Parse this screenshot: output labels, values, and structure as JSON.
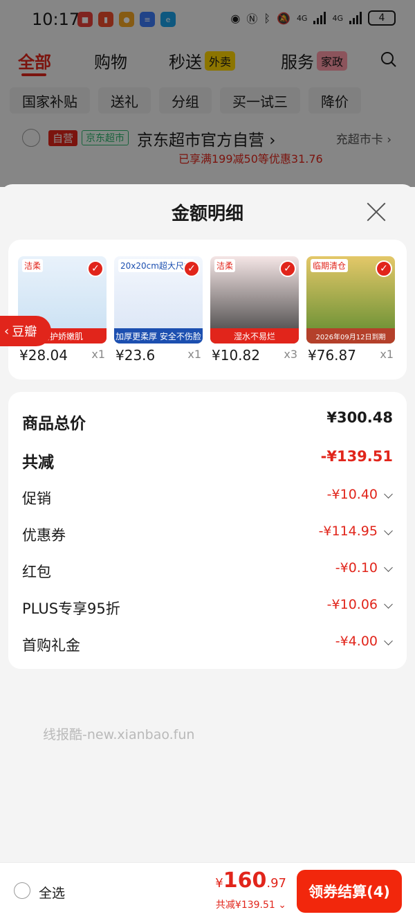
{
  "status_bar": {
    "time": "10:17",
    "battery": "4",
    "network_1": "4G",
    "network_2": "4G"
  },
  "top_tabs": [
    {
      "label": "全部",
      "active": true
    },
    {
      "label": "购物",
      "active": false
    },
    {
      "label": "秒送",
      "badge": "外卖",
      "active": false
    },
    {
      "label": "服务",
      "badge": "家政",
      "active": false
    }
  ],
  "filter_chips": [
    "国家补贴",
    "送礼",
    "分组",
    "买一试三",
    "降价"
  ],
  "store": {
    "tag_self": "自营",
    "tag_market": "京东超市",
    "name": "京东超市官方自营",
    "card_link": "充超市卡",
    "promo": "已享满199减50等优惠31.76"
  },
  "sheet": {
    "title": "金额明细"
  },
  "products": [
    {
      "price": "¥28.04",
      "qty": "x1",
      "label": "洁柔",
      "band": "呵护娇嫩肌",
      "color": "#c7dff2"
    },
    {
      "price": "¥23.6",
      "qty": "x1",
      "label": "20x20cm超大尺寸",
      "band": "加厚更柔厚 安全不伤脸",
      "color": "#d9e4f5"
    },
    {
      "price": "¥10.82",
      "qty": "x3",
      "label": "洁柔",
      "band": "湿水不易烂",
      "color": "#3a3a3a"
    },
    {
      "price": "¥76.87",
      "qty": "x1",
      "label": "临期清仓",
      "band": "2026年09月12日到期",
      "color": "#c9a23a"
    }
  ],
  "side_tag": "豆瓣",
  "price_detail": {
    "total_label": "商品总价",
    "total_value": "¥300.48",
    "discount_label": "共减",
    "discount_value": "-¥139.51",
    "items": [
      {
        "label": "促销",
        "value": "-¥10.40"
      },
      {
        "label": "优惠券",
        "value": "-¥114.95"
      },
      {
        "label": "红包",
        "value": "-¥0.10"
      },
      {
        "label": "PLUS专享95折",
        "value": "-¥10.06"
      },
      {
        "label": "首购礼金",
        "value": "-¥4.00"
      }
    ]
  },
  "watermark": "线报酷-new.xianbao.fun",
  "bottom_bar": {
    "select_all": "全选",
    "total_symbol": "¥",
    "total_int": "160",
    "total_dec": ".97",
    "total_discount": "共减¥139.51",
    "checkout": "领券结算(4)"
  },
  "colors": {
    "brand_red": "#e1251b",
    "checkout_red": "#f2270c"
  }
}
